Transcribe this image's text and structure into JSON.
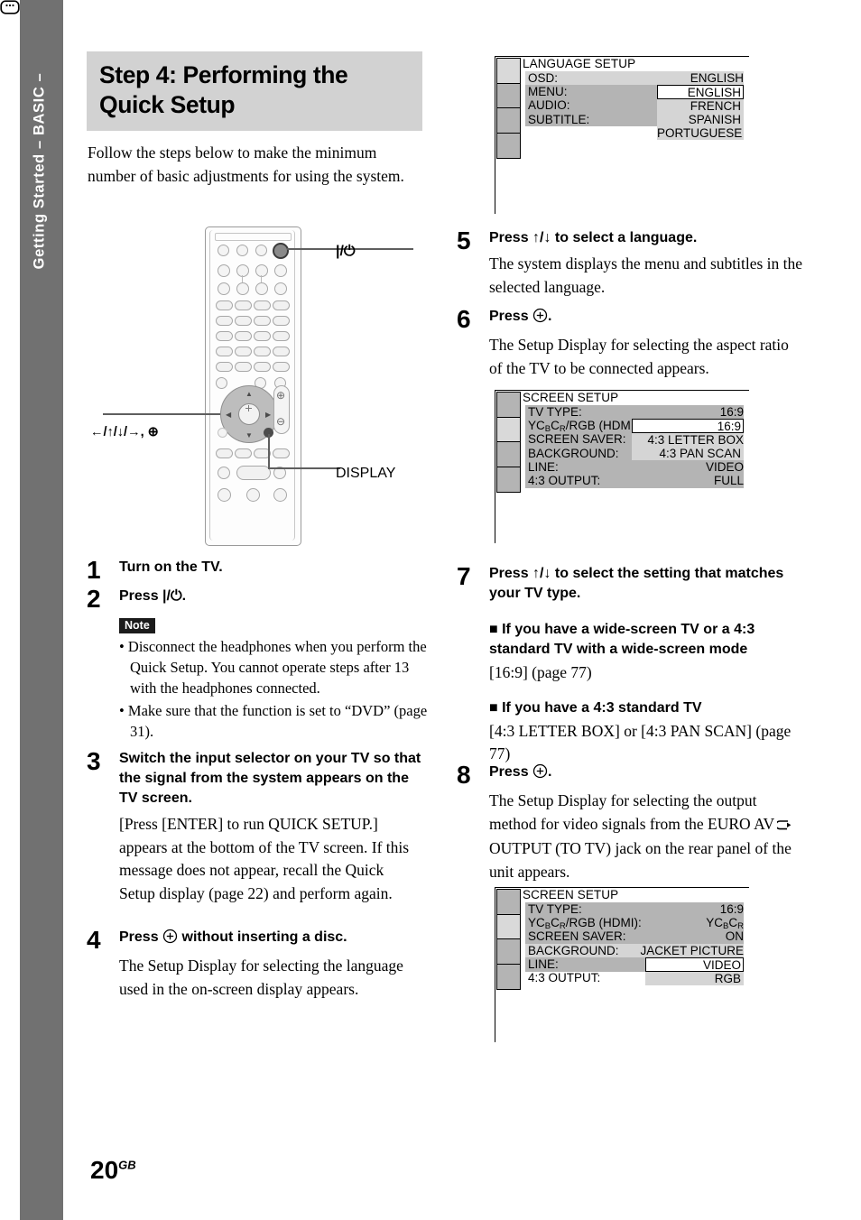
{
  "sidebar": {
    "label": "Getting Started – BASIC –"
  },
  "heading": {
    "line1": "Step 4: Performing the",
    "line2": "Quick Setup"
  },
  "intro": "Follow the steps below to make the minimum number of basic adjustments for using the system.",
  "remote": {
    "power_label": "|/⏻",
    "arrows_label": "←/↑/↓/→,  ⊕",
    "display_label": "DISPLAY",
    "display_icon": "display-button-icon"
  },
  "steps": [
    {
      "num": "1",
      "title": "Turn on the TV.",
      "text": ""
    },
    {
      "num": "2",
      "title": "Press |/⏻.",
      "note_tag": "Note",
      "notes": [
        "Disconnect the headphones when you perform the Quick Setup. You cannot operate steps after 13 with the headphones connected.",
        "Make sure that the function is set to “DVD” (page 31)."
      ]
    },
    {
      "num": "3",
      "title": "Switch the input selector on your TV so that the signal from the system appears on the TV screen.",
      "text": "[Press [ENTER] to run QUICK SETUP.] appears at the bottom of the TV screen. If this message does not appear, recall the Quick Setup display (page 22) and perform again."
    },
    {
      "num": "4",
      "title_a": "Press",
      "title_b": "without inserting a disc.",
      "text": "The Setup Display for selecting the language used in the on-screen display appears."
    },
    {
      "num": "5",
      "title": "Press ↑/↓ to select a language.",
      "text": "The system displays the menu and subtitles in the selected language."
    },
    {
      "num": "6",
      "title_a": "Press",
      "title_b": ".",
      "text": "The Setup Display for selecting the aspect ratio of the TV to be connected appears."
    },
    {
      "num": "7",
      "title": "Press ↑/↓ to select the setting that matches your TV type.",
      "sub1_title": "If you have a wide-screen TV or a 4:3 standard TV with a wide-screen mode",
      "sub1_text": "[16:9] (page 77)",
      "sub2_title": "If you have a 4:3 standard TV",
      "sub2_text": "[4:3 LETTER BOX] or [4:3 PAN SCAN] (page 77)"
    },
    {
      "num": "8",
      "title_a": "Press",
      "title_b": ".",
      "text_a": "The Setup Display for selecting the output method for video signals from the EURO AV",
      "text_b": "OUTPUT (TO TV) jack on the rear panel of the unit appears."
    }
  ],
  "osd_language": {
    "title": "LANGUAGE SETUP",
    "selected_tab_index": 0,
    "tab_count": 4,
    "rows": [
      {
        "label": "OSD:",
        "value": "ENGLISH"
      },
      {
        "label": "MENU:",
        "value": ""
      },
      {
        "label": "AUDIO:",
        "value": ""
      },
      {
        "label": "SUBTITLE:",
        "value": ""
      }
    ],
    "dropdown": {
      "selected": "ENGLISH",
      "options": [
        "ENGLISH",
        "FRENCH",
        "SPANISH",
        "PORTUGUESE"
      ]
    }
  },
  "osd_screen_1": {
    "title": "SCREEN SETUP",
    "selected_tab_index": 1,
    "tab_count": 4,
    "rows": [
      {
        "label": "TV TYPE:",
        "value": "16:9"
      },
      {
        "label": "YCBCR/RGB (HDMI):",
        "value": ""
      },
      {
        "label": "SCREEN SAVER:",
        "value": ""
      },
      {
        "label": "BACKGROUND:",
        "value": ""
      },
      {
        "label": "LINE:",
        "value": "VIDEO"
      },
      {
        "label": "4:3 OUTPUT:",
        "value": "FULL"
      }
    ],
    "dropdown": {
      "selected": "16:9",
      "options": [
        "16:9",
        "4:3 LETTER BOX",
        "4:3 PAN SCAN"
      ]
    }
  },
  "osd_screen_2": {
    "title": "SCREEN SETUP",
    "selected_tab_index": 1,
    "tab_count": 4,
    "rows": [
      {
        "label": "TV TYPE:",
        "value": "16:9"
      },
      {
        "label": "YCBCR/RGB (HDMI):",
        "value": "YCBCR"
      },
      {
        "label": "SCREEN SAVER:",
        "value": "ON"
      },
      {
        "label": "BACKGROUND:",
        "value": "JACKET PICTURE"
      },
      {
        "label": "LINE:",
        "value": "VIDEO"
      },
      {
        "label": "4:3 OUTPUT:",
        "value": ""
      }
    ],
    "dropdown": {
      "selected": "VIDEO",
      "options": [
        "VIDEO",
        "RGB"
      ]
    }
  },
  "page_number": {
    "num": "20",
    "suffix": "GB"
  }
}
